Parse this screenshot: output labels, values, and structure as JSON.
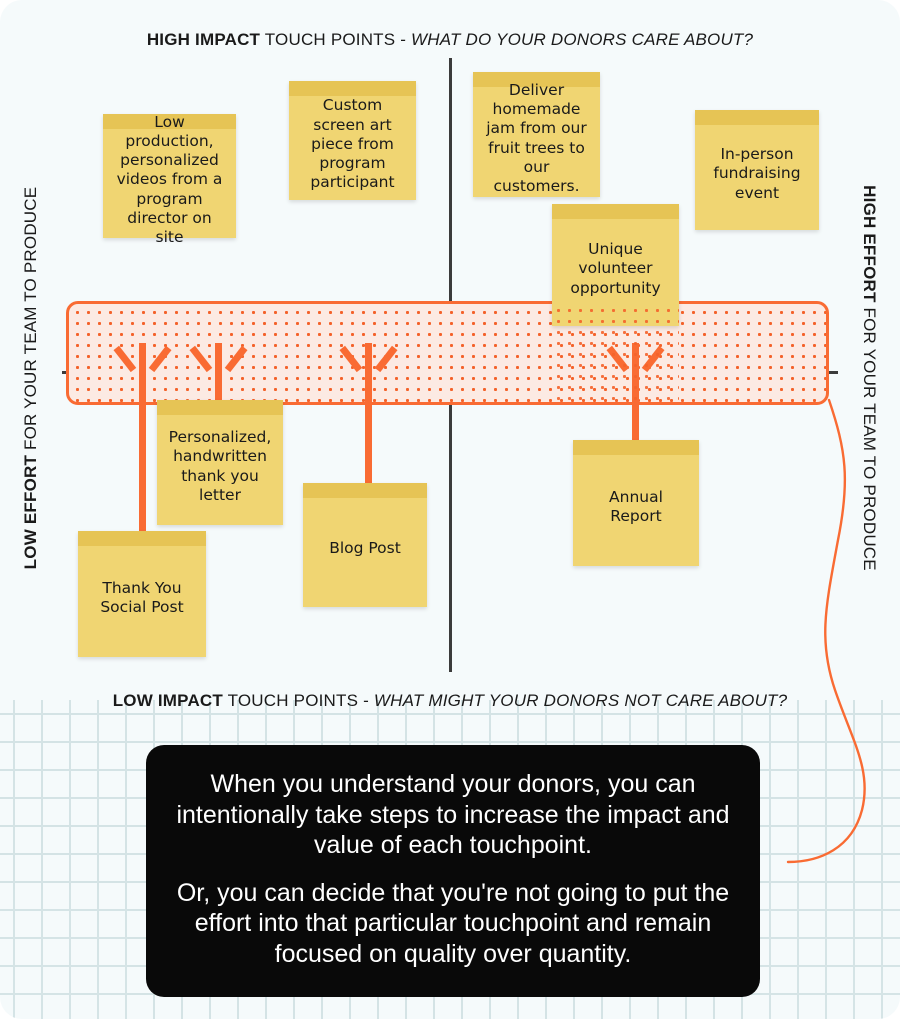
{
  "colors": {
    "background": "#f5fafb",
    "note_body": "#f0d572",
    "note_top": "#e6c455",
    "accent_orange": "#f96b33",
    "band_fill": "#fceae3",
    "axis": "#3b3b3b",
    "callout_bg": "#090909",
    "pattern": "#cfe0e2"
  },
  "headings": {
    "top": {
      "bold": "HIGH IMPACT",
      "normal": " TOUCH POINTS - ",
      "italic": "WHAT DO YOUR DONORS CARE ABOUT?"
    },
    "bottom": {
      "bold": "LOW IMPACT",
      "normal": " TOUCH POINTS - ",
      "italic": "WHAT MIGHT YOUR DONORS NOT CARE ABOUT?"
    },
    "left": {
      "bold": "LOW EFFORT",
      "normal": " FOR YOUR TEAM TO PRODUCE"
    },
    "right": {
      "bold": "HIGH EFFORT",
      "normal": " FOR YOUR TEAM TO PRODUCE"
    }
  },
  "notes": [
    {
      "id": "low-production-videos",
      "text": "Low production, personalized videos from a program director on site",
      "quadrant": "high-impact-high-effort"
    },
    {
      "id": "custom-screen-art",
      "text": "Custom screen art piece from program participant",
      "quadrant": "high-impact-high-effort"
    },
    {
      "id": "homemade-jam",
      "text": "Deliver homemade jam from our fruit trees to our customers.",
      "quadrant": "low-impact-high-effort"
    },
    {
      "id": "in-person-fundraising-event",
      "text": "In-person fundraising event",
      "quadrant": "low-impact-high-effort"
    },
    {
      "id": "unique-volunteer-opportunity",
      "text": "Unique volunteer opportunity",
      "quadrant": "low-impact-high-effort"
    },
    {
      "id": "personalized-thank-you-letter",
      "text": "Personalized, handwritten thank you letter",
      "quadrant": "high-impact-low-effort"
    },
    {
      "id": "thank-you-social-post",
      "text": "Thank You Social Post",
      "quadrant": "high-impact-low-effort"
    },
    {
      "id": "blog-post",
      "text": "Blog Post",
      "quadrant": "high-impact-low-effort"
    },
    {
      "id": "annual-report",
      "text": "Annual Report",
      "quadrant": "low-impact-low-effort"
    }
  ],
  "callout": {
    "paragraph_1": "When you understand your donors, you can intentionally take steps to increase the impact and value of each touchpoint.",
    "paragraph_2": "Or, you can decide that you're not going to put the effort into that particular touchpoint and remain focused on quality over quantity."
  }
}
